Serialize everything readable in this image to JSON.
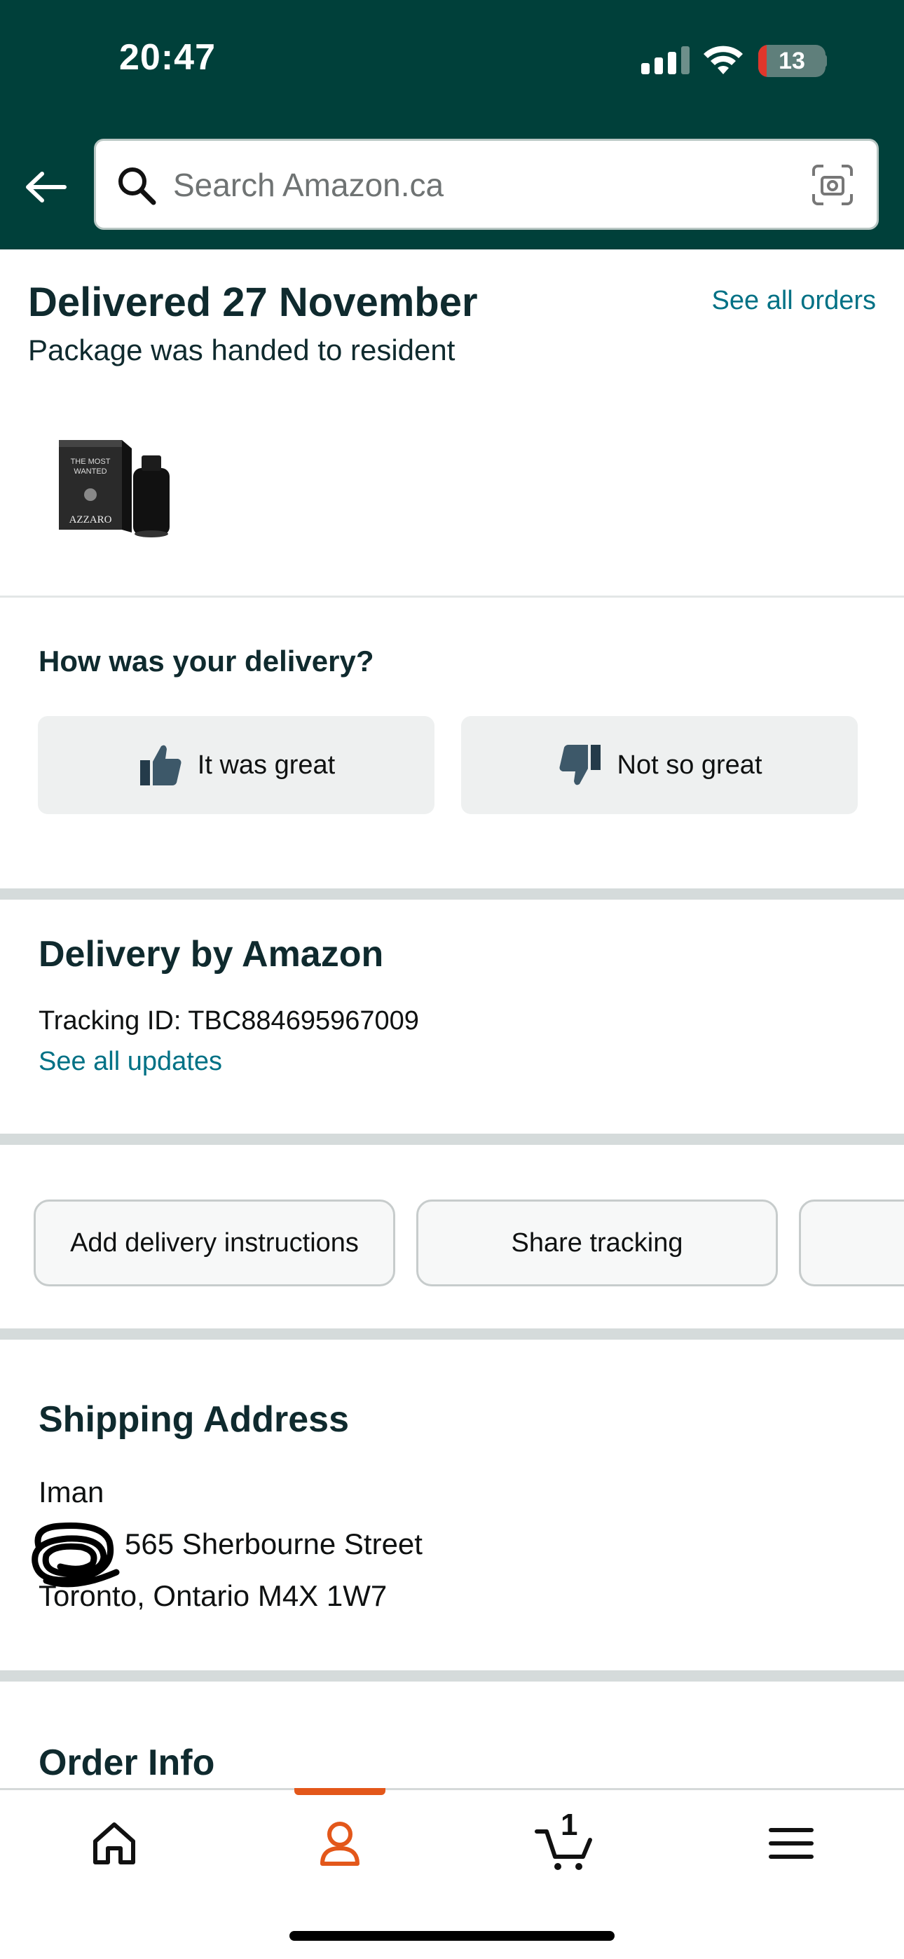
{
  "status_bar": {
    "time": "20:47",
    "battery_level": "13",
    "battery_fraction": 0.13
  },
  "search": {
    "placeholder": "Search Amazon.ca"
  },
  "delivery_status": {
    "title": "Delivered 27 November",
    "subtitle": "Package was handed to resident",
    "see_all_orders": "See all orders"
  },
  "feedback": {
    "question": "How was your delivery?",
    "great_label": "It was great",
    "not_great_label": "Not so great"
  },
  "carrier": {
    "title": "Delivery by Amazon",
    "tracking_id": "Tracking ID: TBC884695967009",
    "see_updates": "See all updates"
  },
  "actions": {
    "add_instructions": "Add delivery instructions",
    "share_tracking": "Share tracking"
  },
  "shipping": {
    "title": "Shipping Address",
    "name": "Iman",
    "street": "565 Sherbourne Street",
    "city_line": "Toronto, Ontario M4X 1W7"
  },
  "order_info": {
    "title": "Order Info"
  },
  "bottom_nav": {
    "cart_count": "1",
    "active_tab": "account",
    "accent_color": "#e3571a"
  },
  "colors": {
    "header_bg": "#00403a",
    "link": "#007185"
  },
  "icons": [
    "back-arrow-icon",
    "search-icon",
    "camera-icon",
    "thumbs-up-icon",
    "thumbs-down-icon",
    "home-icon",
    "account-icon",
    "cart-icon",
    "menu-icon"
  ]
}
